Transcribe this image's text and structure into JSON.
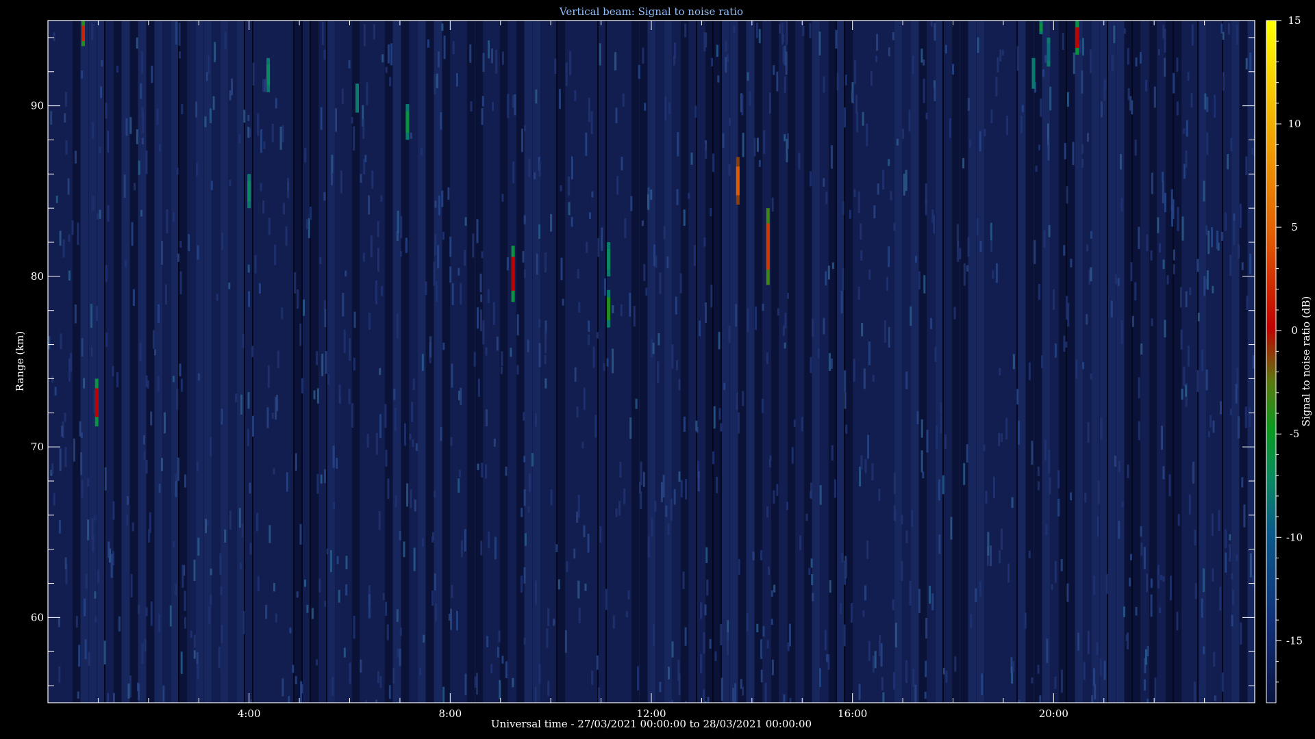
{
  "chart_data": {
    "type": "heatmap",
    "title": "Vertical beam: Signal to noise ratio",
    "xlabel": "Universal time - 27/03/2021 00:00:00 to 28/03/2021 00:00:00",
    "ylabel": "Range (km)",
    "colorbar_label": "Signal to noise ratio (dB)",
    "xlim_hours": [
      0,
      24
    ],
    "ylim_km": [
      55,
      95
    ],
    "clim_db": [
      -18,
      15
    ],
    "x_ticks": [
      {
        "value": 4,
        "label": "4:00"
      },
      {
        "value": 8,
        "label": "8:00"
      },
      {
        "value": 12,
        "label": "12:00"
      },
      {
        "value": 16,
        "label": "16:00"
      },
      {
        "value": 20,
        "label": "20:00"
      }
    ],
    "y_ticks": [
      {
        "value": 60,
        "label": "60"
      },
      {
        "value": 70,
        "label": "70"
      },
      {
        "value": 80,
        "label": "80"
      },
      {
        "value": 90,
        "label": "90"
      }
    ],
    "colorbar_ticks": [
      {
        "value": 15,
        "label": "15"
      },
      {
        "value": 10,
        "label": "10"
      },
      {
        "value": 5,
        "label": "5"
      },
      {
        "value": 0,
        "label": "0"
      },
      {
        "value": -5,
        "label": "-5"
      },
      {
        "value": -10,
        "label": "-10"
      },
      {
        "value": -15,
        "label": "-15"
      }
    ],
    "background_level_db": -15,
    "echoes": [
      {
        "time_h": 0.7,
        "range_from_km": 93.5,
        "range_to_km": 95.0,
        "peak_db": 2
      },
      {
        "time_h": 0.97,
        "range_from_km": 71.2,
        "range_to_km": 74.0,
        "peak_db": 0
      },
      {
        "time_h": 4.0,
        "range_from_km": 84.0,
        "range_to_km": 86.0,
        "peak_db": -7
      },
      {
        "time_h": 4.38,
        "range_from_km": 90.8,
        "range_to_km": 92.8,
        "peak_db": -7
      },
      {
        "time_h": 6.15,
        "range_from_km": 89.6,
        "range_to_km": 91.3,
        "peak_db": -8
      },
      {
        "time_h": 7.15,
        "range_from_km": 88.0,
        "range_to_km": 90.1,
        "peak_db": -6
      },
      {
        "time_h": 9.25,
        "range_from_km": 78.5,
        "range_to_km": 81.8,
        "peak_db": 0
      },
      {
        "time_h": 11.15,
        "range_from_km": 80.0,
        "range_to_km": 82.0,
        "peak_db": -7
      },
      {
        "time_h": 11.15,
        "range_from_km": 77.0,
        "range_to_km": 79.2,
        "peak_db": -4
      },
      {
        "time_h": 13.72,
        "range_from_km": 84.2,
        "range_to_km": 87.0,
        "peak_db": 5
      },
      {
        "time_h": 14.32,
        "range_from_km": 79.5,
        "range_to_km": 84.0,
        "peak_db": 3
      },
      {
        "time_h": 19.6,
        "range_from_km": 91.0,
        "range_to_km": 92.8,
        "peak_db": -8
      },
      {
        "time_h": 19.75,
        "range_from_km": 94.2,
        "range_to_km": 95.0,
        "peak_db": -6
      },
      {
        "time_h": 19.9,
        "range_from_km": 92.3,
        "range_to_km": 94.0,
        "peak_db": -9
      },
      {
        "time_h": 20.47,
        "range_from_km": 93.0,
        "range_to_km": 95.0,
        "peak_db": 0
      }
    ]
  }
}
